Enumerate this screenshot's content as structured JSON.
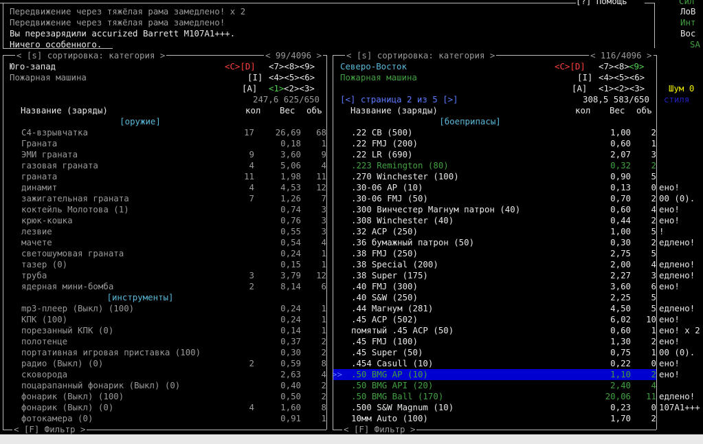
{
  "messages": {
    "help_label": "[?] Помощь",
    "lines": [
      "Передвижение через тяжёлая рама замедлено! x 2",
      "Передвижение через тяжёлая рама замедлено!",
      "Вы перезарядили accurized Barrett M107A1+++.",
      "Ничего особенного."
    ]
  },
  "side_panel": {
    "top": "Сил",
    "str": "ЛоВ",
    "int": "Инт",
    "per": "Вос",
    "sa": "SA",
    "noise": "Шум 0",
    "style": "стиля",
    "msgs": [
      "ено!",
      "00 (0).",
      "ено!",
      "ено!",
      "!",
      "едлено!",
      "",
      "едлено!",
      "едлено!",
      "ено!",
      "",
      "едлено!",
      "ено!",
      "ено! x 2",
      "ено!",
      "00 (0).",
      "ено!",
      "ено!",
      "",
      "едлено!",
      "107A1+++"
    ]
  },
  "left": {
    "sort_label": "< [s] сортировка: категория >",
    "capacity": "< 99/4096 >",
    "direction": "Юго-запад",
    "location": "Пожарная машина",
    "keys_cd": "<C>[D]",
    "keys_row1": "<7><8><9>",
    "keys_row2": "<4><5><6>",
    "keys_row3_a": "<1>",
    "keys_row3_b": "<2><3>",
    "key_i": "[I]",
    "key_a": "[A]",
    "weight_vol": "247,6 625/650",
    "header": {
      "name": "Название (заряды)",
      "qty": "кол",
      "weight": "Вес",
      "vol": "объ"
    },
    "filter": "< [F] Фильтр >",
    "rows": [
      {
        "type": "cat",
        "name": "[оружие]"
      },
      {
        "name": "C4-взрывчатка",
        "qty": "17",
        "w": "26,69",
        "v": "68"
      },
      {
        "name": "Граната",
        "qty": "",
        "w": "0,18",
        "v": "1"
      },
      {
        "name": "ЭМИ граната",
        "qty": "9",
        "w": "3,60",
        "v": "9"
      },
      {
        "name": "газовая граната",
        "qty": "4",
        "w": "5,06",
        "v": "4"
      },
      {
        "name": "граната",
        "qty": "11",
        "w": "1,98",
        "v": "11"
      },
      {
        "name": "динамит",
        "qty": "4",
        "w": "4,53",
        "v": "12"
      },
      {
        "name": "зажигательная граната",
        "qty": "7",
        "w": "1,26",
        "v": "7"
      },
      {
        "name": "коктейль Молотова (1)",
        "qty": "",
        "w": "0,74",
        "v": "3"
      },
      {
        "name": "крюк-кошка",
        "qty": "",
        "w": "0,76",
        "v": "3"
      },
      {
        "name": "лезвие",
        "qty": "",
        "w": "0,55",
        "v": "3"
      },
      {
        "name": "мачете",
        "qty": "",
        "w": "0,54",
        "v": "4"
      },
      {
        "name": "светошумовая граната",
        "qty": "",
        "w": "0,24",
        "v": "1"
      },
      {
        "name": "тазер (0)",
        "qty": "",
        "w": "0,15",
        "v": "1"
      },
      {
        "name": "труба",
        "qty": "3",
        "w": "3,79",
        "v": "12"
      },
      {
        "name": "ядерная мини-бомба",
        "qty": "2",
        "w": "8,14",
        "v": "6"
      },
      {
        "type": "cat",
        "name": "[инструменты]"
      },
      {
        "name": "mp3-плеер (Выкл) (100)",
        "qty": "",
        "w": "0,24",
        "v": "1"
      },
      {
        "name": "КПК (100)",
        "qty": "",
        "w": "0,24",
        "v": "1"
      },
      {
        "name": "порезанный КПК (0)",
        "qty": "",
        "w": "0,14",
        "v": "1"
      },
      {
        "name": "полотенце",
        "qty": "",
        "w": "0,37",
        "v": "2"
      },
      {
        "name": "портативная игровая приставка (100)",
        "qty": "",
        "w": "0,30",
        "v": "2"
      },
      {
        "name": "радио (Выкл) (0)",
        "qty": "2",
        "w": "0,59",
        "v": "8"
      },
      {
        "name": "сковорода",
        "qty": "",
        "w": "2,63",
        "v": "4"
      },
      {
        "name": "поцарапанный фонарик (Выкл) (0)",
        "qty": "",
        "w": "0,40",
        "v": "2"
      },
      {
        "name": "фонарик (Выкл) (100)",
        "qty": "",
        "w": "0,50",
        "v": "2"
      },
      {
        "name": "фонарик (Выкл) (0)",
        "qty": "4",
        "w": "1,60",
        "v": "8"
      },
      {
        "name": "фотокамера (0)",
        "qty": "",
        "w": "0,91",
        "v": "1"
      }
    ]
  },
  "right": {
    "sort_label": "< [s] сортировка: категория >",
    "capacity": "< 116/4096 >",
    "direction": "Северо-Восток",
    "location": "Пожарная машина",
    "keys_cd": "<C>[D]",
    "keys_row1_a": "<7><8>",
    "keys_row1_b": "<9>",
    "keys_row2": "<4><5><6>",
    "keys_row3": "<1><2><3>",
    "key_i": "[I]",
    "key_a": "[A]",
    "page": "[<] страница 2 из 5 [>]",
    "weight_vol": "308,5 583/650",
    "header": {
      "name": "Название (заряды)",
      "qty": "кол",
      "weight": "Вес",
      "vol": "объ"
    },
    "filter": "< [F] Фильтр >",
    "cursor": ">>",
    "rows": [
      {
        "type": "cat",
        "name": "[боеприпасы]"
      },
      {
        "name": ".22 CB (500)",
        "w": "1,00",
        "v": "2"
      },
      {
        "name": ".22 FMJ (200)",
        "w": "0,60",
        "v": "1"
      },
      {
        "name": ".22 LR (690)",
        "w": "2,07",
        "v": "3"
      },
      {
        "name": ".223 Remington (80)",
        "w": "0,32",
        "v": "2",
        "color": "dg"
      },
      {
        "name": ".270 Winchester (100)",
        "w": "0,90",
        "v": "5"
      },
      {
        "name": ".30-06 AP (10)",
        "w": "0,13",
        "v": "0"
      },
      {
        "name": ".30-06 FMJ (50)",
        "w": "0,70",
        "v": "2"
      },
      {
        "name": ".300 Винчестер Магнум патрон (40)",
        "w": "0,60",
        "v": "4"
      },
      {
        "name": ".308 Winchester (40)",
        "w": "0,44",
        "v": "2"
      },
      {
        "name": ".32 ACP (250)",
        "w": "1,00",
        "v": "5"
      },
      {
        "name": ".36 бумажный патрон (50)",
        "w": "0,30",
        "v": "2"
      },
      {
        "name": ".38 FMJ (250)",
        "w": "2,75",
        "v": "5"
      },
      {
        "name": ".38 Special (200)",
        "w": "2,00",
        "v": "4"
      },
      {
        "name": ".38 Super (175)",
        "w": "2,27",
        "v": "3"
      },
      {
        "name": ".40 FMJ (300)",
        "w": "3,60",
        "v": "6"
      },
      {
        "name": ".40 S&W (250)",
        "w": "2,25",
        "v": "5"
      },
      {
        "name": ".44 Магнум (281)",
        "w": "4,50",
        "v": "5"
      },
      {
        "name": ".45 ACP (502)",
        "w": "6,02",
        "v": "10"
      },
      {
        "name": "помятый .45 ACP (50)",
        "w": "0,60",
        "v": "1"
      },
      {
        "name": ".45 FMJ (100)",
        "w": "1,30",
        "v": "2"
      },
      {
        "name": ".45 Super (50)",
        "w": "0,75",
        "v": "1"
      },
      {
        "name": ".454 Casull (10)",
        "w": "0,22",
        "v": "0"
      },
      {
        "name": ".50 BMG AP (10)",
        "w": "1,10",
        "v": "2",
        "color": "dg",
        "selected": true
      },
      {
        "name": ".50 BMG API (20)",
        "w": "2,40",
        "v": "4",
        "color": "dg"
      },
      {
        "name": ".50 BMG Ball (170)",
        "w": "20,06",
        "v": "11",
        "color": "dg"
      },
      {
        "name": ".500 S&W Magnum (10)",
        "w": "0,23",
        "v": "0"
      },
      {
        "name": "10мм Auto (100)",
        "w": "1,70",
        "v": "2"
      }
    ]
  }
}
